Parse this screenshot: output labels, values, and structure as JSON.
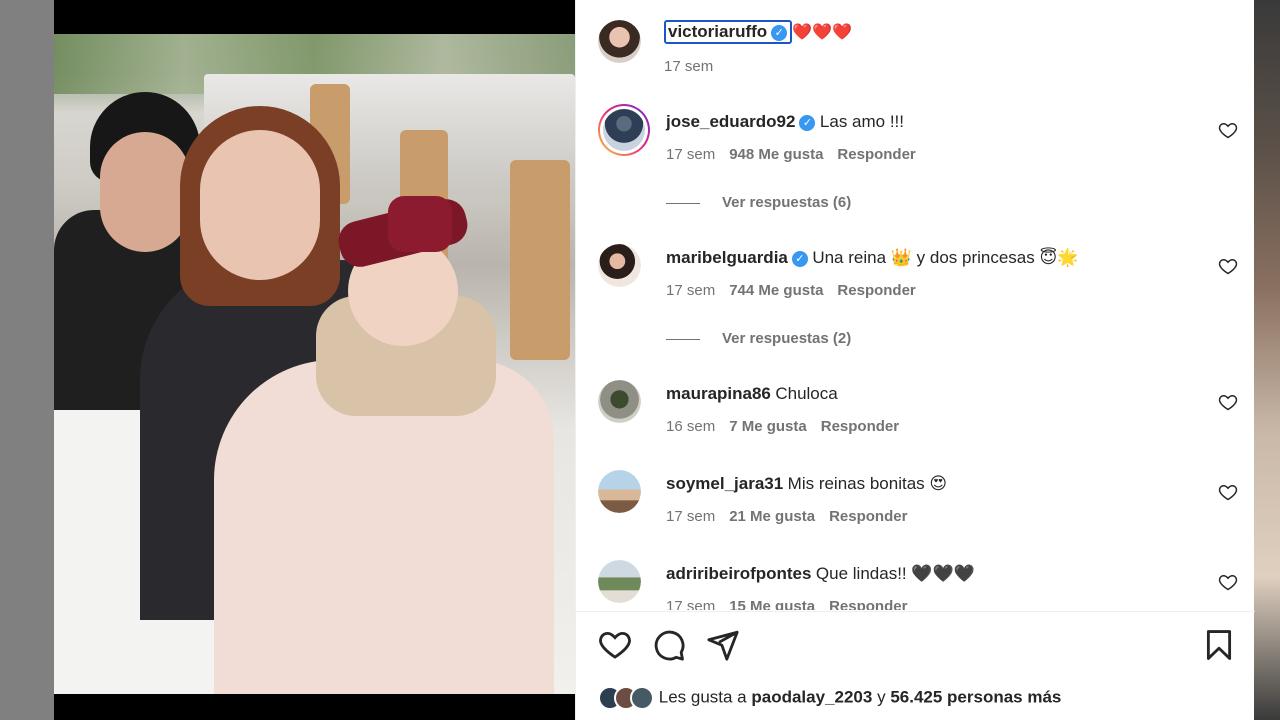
{
  "post": {
    "author": "victoriaruffo",
    "caption_emoji": "❤️❤️❤️",
    "caption_time": "17 sem"
  },
  "comments": [
    {
      "user": "jose_eduardo92",
      "verified": true,
      "text": "Las amo !!!",
      "time": "17 sem",
      "likes": "948 Me gusta",
      "reply": "Responder",
      "view_replies": "Ver respuestas (6)"
    },
    {
      "user": "maribelguardia",
      "verified": true,
      "text": "Una reina 👑 y dos princesas 😇🌟",
      "time": "17 sem",
      "likes": "744 Me gusta",
      "reply": "Responder",
      "view_replies": "Ver respuestas (2)"
    },
    {
      "user": "maurapina86",
      "verified": false,
      "text": "Chuloca",
      "time": "16 sem",
      "likes": "7 Me gusta",
      "reply": "Responder"
    },
    {
      "user": "soymel_jara31",
      "verified": false,
      "text": "Mis reinas bonitas 😍",
      "time": "17 sem",
      "likes": "21 Me gusta",
      "reply": "Responder"
    },
    {
      "user": "adriribeirofpontes",
      "verified": false,
      "text": "Que lindas!! 🖤🖤🖤",
      "time": "17 sem",
      "likes": "15 Me gusta",
      "reply": "Responder"
    }
  ],
  "likes_summary": {
    "prefix": "Les gusta a",
    "user": "paodalay_2203",
    "conj": "y",
    "count": "56.425 personas más"
  },
  "icons": {
    "like": "heart-outline-icon",
    "comment": "comment-bubble-icon",
    "share": "paper-plane-icon",
    "save": "bookmark-icon",
    "verified": "verified-badge-icon"
  },
  "colors": {
    "verified": "#3897f0",
    "text": "#262626",
    "muted": "#737373",
    "focus": "#1a57c4"
  }
}
